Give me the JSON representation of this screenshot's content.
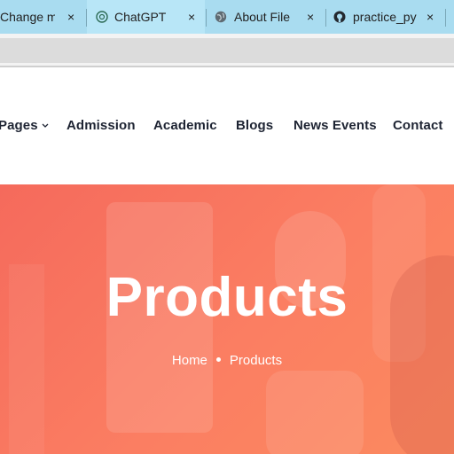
{
  "browser": {
    "tabs": [
      {
        "title": "Change mo",
        "favicon": "generic-page-icon",
        "close": "×"
      },
      {
        "title": "ChatGPT",
        "favicon": "chatgpt-icon",
        "close": "×"
      },
      {
        "title": "About File",
        "favicon": "globe-icon",
        "close": "×"
      },
      {
        "title": "practice_py",
        "favicon": "github-icon",
        "close": "×"
      }
    ],
    "accent": "#a9dcf0"
  },
  "nav": {
    "items": [
      "Pages",
      "Admission",
      "Academic",
      "Blogs",
      "News Events",
      "Contact"
    ],
    "pages_has_dropdown": true,
    "text_color": "#1e2433"
  },
  "hero": {
    "title": "Products",
    "breadcrumb": {
      "home": "Home",
      "current": "Products"
    },
    "overlay_color": "#f56a5c"
  }
}
